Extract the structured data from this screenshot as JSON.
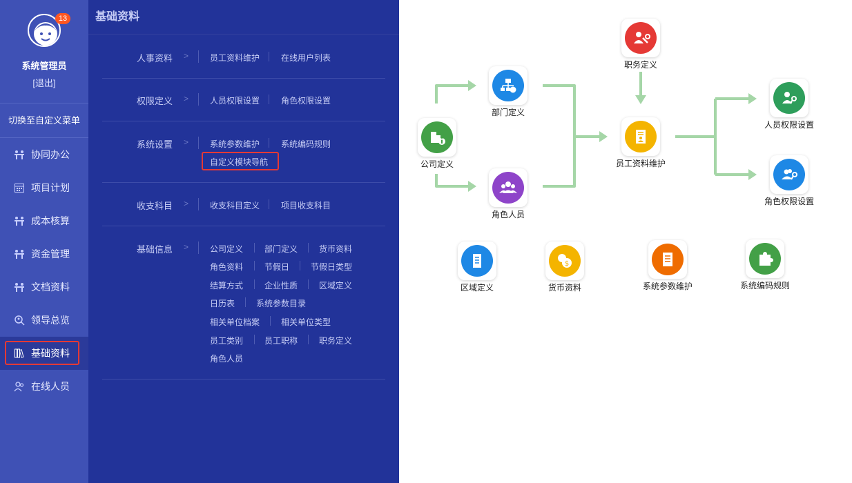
{
  "sidebar": {
    "badge": "13",
    "username": "系统管理员",
    "logout": "[退出]",
    "switch_menu": "切换至自定义菜单",
    "items": [
      {
        "label": "协同办公",
        "icon": "team-icon"
      },
      {
        "label": "项目计划",
        "icon": "calendar-icon"
      },
      {
        "label": "成本核算",
        "icon": "team-icon"
      },
      {
        "label": "资金管理",
        "icon": "team-icon"
      },
      {
        "label": "文档资料",
        "icon": "team-icon"
      },
      {
        "label": "领导总览",
        "icon": "search-person-icon"
      },
      {
        "label": "基础资料",
        "icon": "books-icon",
        "active": true
      },
      {
        "label": "在线人员",
        "icon": "people-icon"
      }
    ]
  },
  "panel": {
    "title": "基础资料",
    "sections": [
      {
        "category": "人事资料",
        "links": [
          "员工资料维护",
          "在线用户列表"
        ]
      },
      {
        "category": "权限定义",
        "links": [
          "人员权限设置",
          "角色权限设置"
        ]
      },
      {
        "category": "系统设置",
        "links": [
          "系统参数维护",
          "系统编码规则",
          "自定义模块导航"
        ]
      },
      {
        "category": "收支科目",
        "links": [
          "收支科目定义",
          "项目收支科目"
        ]
      },
      {
        "category": "基础信息",
        "links": [
          "公司定义",
          "部门定义",
          "货币资料",
          "角色资料",
          "节假日",
          "节假日类型",
          "结算方式",
          "企业性质",
          "区域定义",
          "日历表",
          "系统参数目录",
          "相关单位档案",
          "相关单位类型",
          "员工类别",
          "员工职称",
          "职务定义",
          "角色人员"
        ]
      }
    ]
  },
  "flow": {
    "nodes": [
      {
        "label": "公司定义",
        "icon": "company-info-icon",
        "color": "#43a047"
      },
      {
        "label": "部门定义",
        "icon": "org-chart-icon",
        "color": "#1e88e5"
      },
      {
        "label": "角色人员",
        "icon": "role-group-icon",
        "color": "#8e44c9"
      },
      {
        "label": "职务定义",
        "icon": "position-tools-icon",
        "color": "#e53935"
      },
      {
        "label": "员工资料维护",
        "icon": "employee-file-icon",
        "color": "#f4b400"
      },
      {
        "label": "人员权限设置",
        "icon": "user-key-icon",
        "color": "#2e9e5b"
      },
      {
        "label": "角色权限设置",
        "icon": "role-key-icon",
        "color": "#1e88e5"
      },
      {
        "label": "区域定义",
        "icon": "region-doc-icon",
        "color": "#1e88e5"
      },
      {
        "label": "货币资料",
        "icon": "currency-coins-icon",
        "color": "#f4b400"
      },
      {
        "label": "系统参数维护",
        "icon": "parameter-doc-icon",
        "color": "#ef6c00"
      },
      {
        "label": "系统编码规则",
        "icon": "puzzle-icon",
        "color": "#43a047"
      }
    ],
    "arrow_color": "#a5d6a7"
  }
}
